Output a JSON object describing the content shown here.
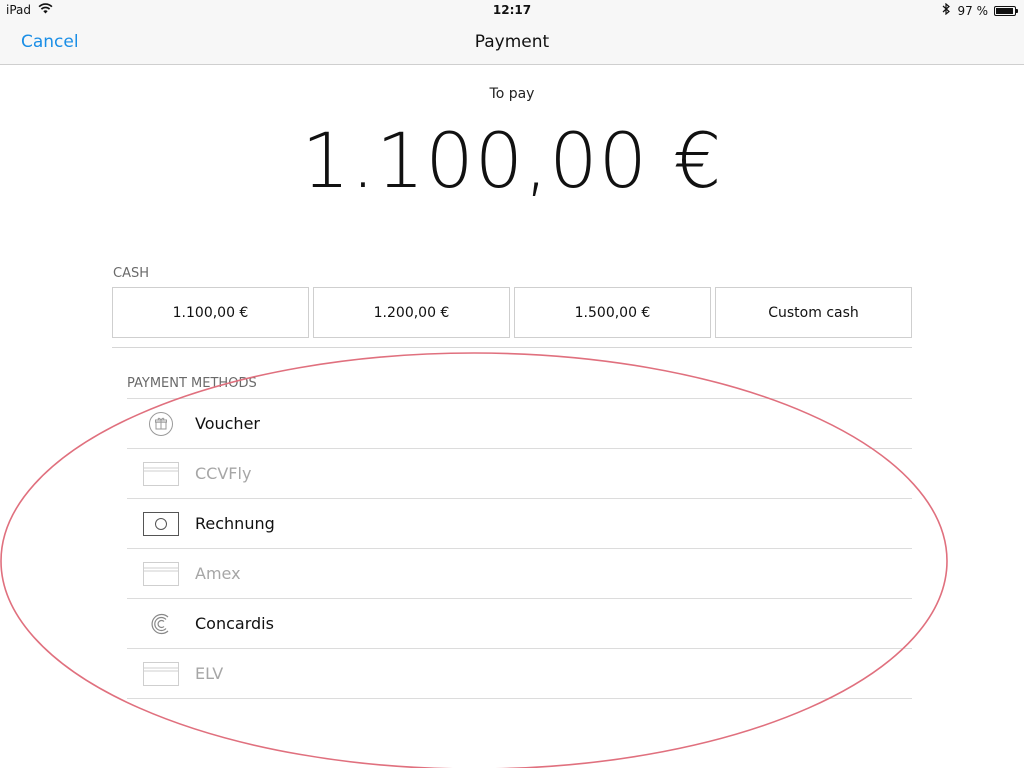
{
  "status_bar": {
    "device": "iPad",
    "time": "12:17",
    "battery_percent": "97 %",
    "battery_level": 0.97
  },
  "nav": {
    "cancel_label": "Cancel",
    "title": "Payment"
  },
  "to_pay": {
    "label": "To pay",
    "amount": "1.100,00 €"
  },
  "cash": {
    "header": "CASH",
    "options": [
      {
        "label": "1.100,00 €"
      },
      {
        "label": "1.200,00 €"
      },
      {
        "label": "1.500,00 €"
      },
      {
        "label": "Custom cash"
      }
    ]
  },
  "payment_methods": {
    "header": "PAYMENT METHODS",
    "items": [
      {
        "label": "Voucher",
        "icon": "gift-icon",
        "enabled": true
      },
      {
        "label": "CCVFly",
        "icon": "credit-card-icon",
        "enabled": false
      },
      {
        "label": "Rechnung",
        "icon": "cash-bill-icon",
        "enabled": true
      },
      {
        "label": "Amex",
        "icon": "credit-card-icon",
        "enabled": false
      },
      {
        "label": "Concardis",
        "icon": "concardis-logo-icon",
        "enabled": true
      },
      {
        "label": "ELV",
        "icon": "credit-card-icon",
        "enabled": false
      }
    ]
  },
  "colors": {
    "accent": "#1a8ee6",
    "annotation": "#e0707e",
    "disabled_text": "#a6a6a6"
  }
}
